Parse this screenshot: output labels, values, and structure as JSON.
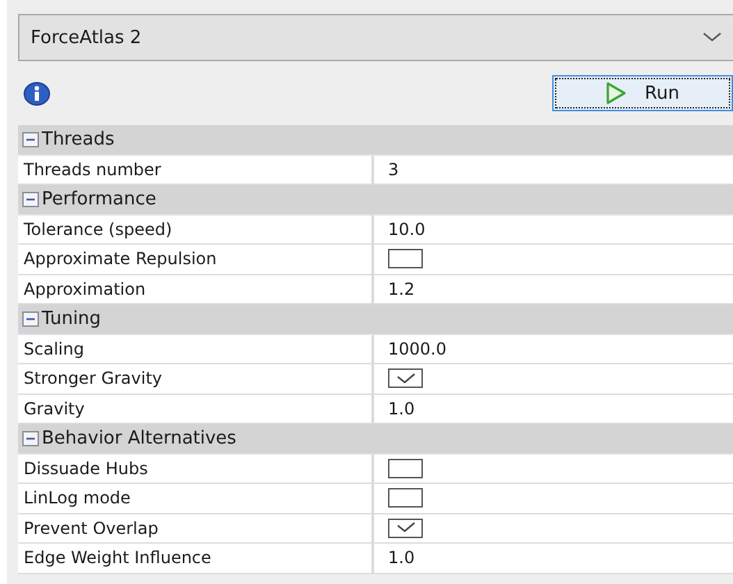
{
  "layout_selector": {
    "value": "ForceAtlas 2"
  },
  "run_button": {
    "label": "Run"
  },
  "sections": [
    {
      "title": "Threads",
      "expanded": true,
      "properties": [
        {
          "kind": "text",
          "name": "Threads number",
          "value": "3"
        }
      ]
    },
    {
      "title": "Performance",
      "expanded": true,
      "properties": [
        {
          "kind": "text",
          "name": "Tolerance (speed)",
          "value": "10.0"
        },
        {
          "kind": "checkbox",
          "name": "Approximate Repulsion",
          "checked": false
        },
        {
          "kind": "text",
          "name": "Approximation",
          "value": "1.2"
        }
      ]
    },
    {
      "title": "Tuning",
      "expanded": true,
      "properties": [
        {
          "kind": "text",
          "name": "Scaling",
          "value": "1000.0"
        },
        {
          "kind": "checkbox",
          "name": "Stronger Gravity",
          "checked": true
        },
        {
          "kind": "text",
          "name": "Gravity",
          "value": "1.0"
        }
      ]
    },
    {
      "title": "Behavior Alternatives",
      "expanded": true,
      "properties": [
        {
          "kind": "checkbox",
          "name": "Dissuade Hubs",
          "checked": false
        },
        {
          "kind": "checkbox",
          "name": "LinLog mode",
          "checked": false
        },
        {
          "kind": "checkbox",
          "name": "Prevent Overlap",
          "checked": true
        },
        {
          "kind": "text",
          "name": "Edge Weight Influence",
          "value": "1.0"
        }
      ]
    }
  ]
}
